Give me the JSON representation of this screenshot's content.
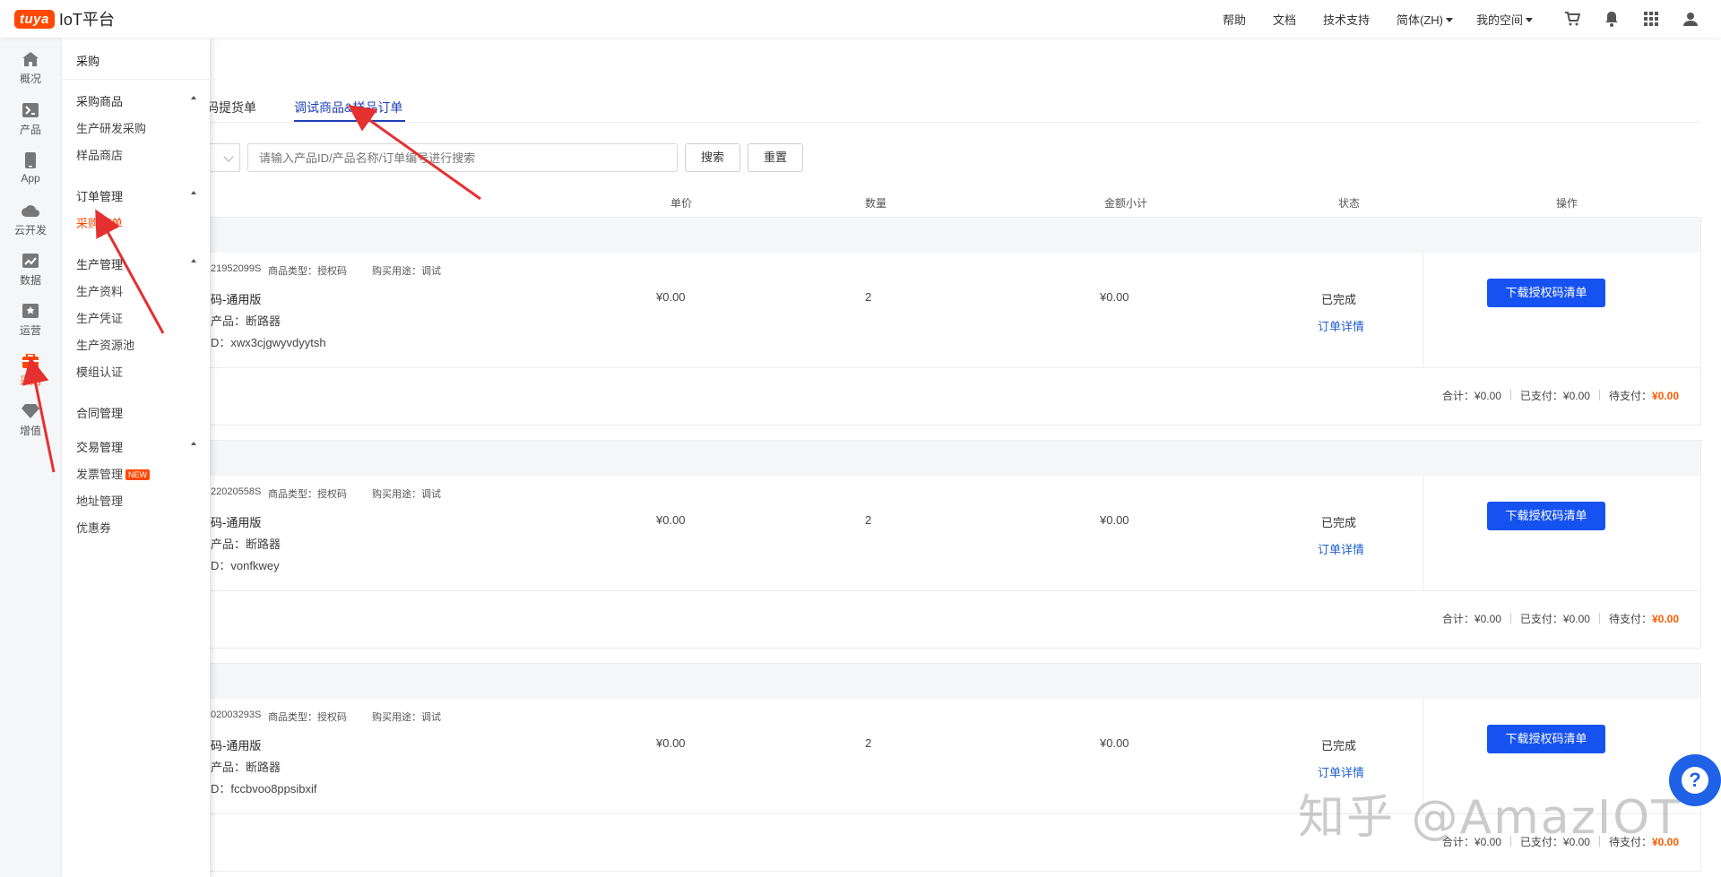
{
  "header": {
    "logo_badge": "tuya",
    "logo_text": "IoT平台",
    "nav": [
      "帮助",
      "文档",
      "技术支持"
    ],
    "language": "简体(ZH)",
    "space": "我的空间"
  },
  "rail": [
    {
      "label": "概况",
      "icon": "home-icon"
    },
    {
      "label": "产品",
      "icon": "terminal-icon"
    },
    {
      "label": "App",
      "icon": "phone-icon"
    },
    {
      "label": "云开发",
      "icon": "cloud-icon"
    },
    {
      "label": "数据",
      "icon": "chart-icon"
    },
    {
      "label": "运营",
      "icon": "star-icon"
    },
    {
      "label": "采购",
      "icon": "purchase-icon"
    },
    {
      "label": "增值",
      "icon": "diamond-icon"
    }
  ],
  "submenu": {
    "title": "采购",
    "groups": [
      {
        "label": "采购商品",
        "items": [
          "生产研发采购",
          "样品商店"
        ]
      },
      {
        "label": "订单管理",
        "items": [
          "采购订单"
        ]
      },
      {
        "label": "生产管理",
        "items": [
          "生产资料",
          "生产凭证",
          "生产资源池",
          "模组认证"
        ]
      },
      {
        "label": "合同管理",
        "items": []
      },
      {
        "label": "交易管理",
        "items": [
          "发票管理",
          "地址管理",
          "优惠券"
        ]
      }
    ],
    "new_badge": "NEW"
  },
  "tabs": [
    "码提货单",
    "调试商品&样品订单"
  ],
  "search": {
    "placeholder": "请输入产品ID/产品名称/订单编号进行搜索",
    "search_label": "搜索",
    "reset_label": "重置"
  },
  "columns": [
    "单价",
    "数量",
    "金额小计",
    "状态",
    "操作"
  ],
  "meta_labels": {
    "type": "商品类型：授权码",
    "purpose": "购买用途：调试"
  },
  "orders": [
    {
      "order_tail": "21952099S",
      "name": "码-通用版",
      "product": "产品：断路器",
      "pid": "D：xwx3cjgwyvdyytsh",
      "price": "¥0.00",
      "qty": "2",
      "subtotal": "¥0.00",
      "status": "已完成",
      "detail": "订单详情",
      "action": "下载授权码清单",
      "total": "合计：¥0.00",
      "paid": "已支付：¥0.00",
      "due_label": "待支付：",
      "due": "¥0.00"
    },
    {
      "order_tail": "22020558S",
      "name": "码-通用版",
      "product": "产品：断路器",
      "pid": "D：vonfkwey",
      "price": "¥0.00",
      "qty": "2",
      "subtotal": "¥0.00",
      "status": "已完成",
      "detail": "订单详情",
      "action": "下载授权码清单",
      "total": "合计：¥0.00",
      "paid": "已支付：¥0.00",
      "due_label": "待支付：",
      "due": "¥0.00"
    },
    {
      "order_tail": "02003293S",
      "name": "码-通用版",
      "product": "产品：断路器",
      "pid": "D：fccbvoo8ppsibxif",
      "price": "¥0.00",
      "qty": "2",
      "subtotal": "¥0.00",
      "status": "已完成",
      "detail": "订单详情",
      "action": "下载授权码清单",
      "total": "合计：¥0.00",
      "paid": "已支付：¥0.00",
      "due_label": "待支付：",
      "due": "¥0.00"
    }
  ],
  "help_icon": "?",
  "watermark": "知乎 @AmazIOT",
  "colors": {
    "brand": "#ff4800",
    "primary": "#1652f0",
    "link": "#1f5fcc",
    "due": "#ff5a00"
  }
}
